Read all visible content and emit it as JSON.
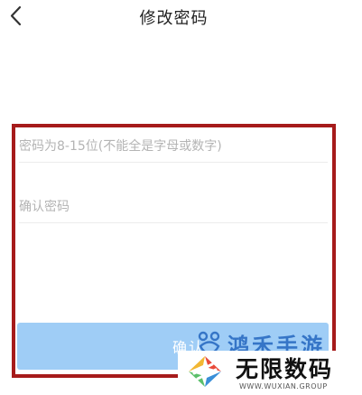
{
  "header": {
    "title": "修改密码",
    "back_icon": "chevron-left-icon"
  },
  "form": {
    "new_password": {
      "value": "",
      "placeholder": "密码为8-15位(不能全是字母或数字)"
    },
    "confirm_password": {
      "value": "",
      "placeholder": "确认密码"
    },
    "confirm_label": "确认"
  },
  "watermark": {
    "top_text": "鸿禾手游",
    "title": "无限数码",
    "url": "WWW.WUXIAN.GROUP"
  },
  "colors": {
    "highlight_border": "#a61b1b",
    "button_bg": "#9fcdf6",
    "placeholder": "#b4b4b4"
  }
}
